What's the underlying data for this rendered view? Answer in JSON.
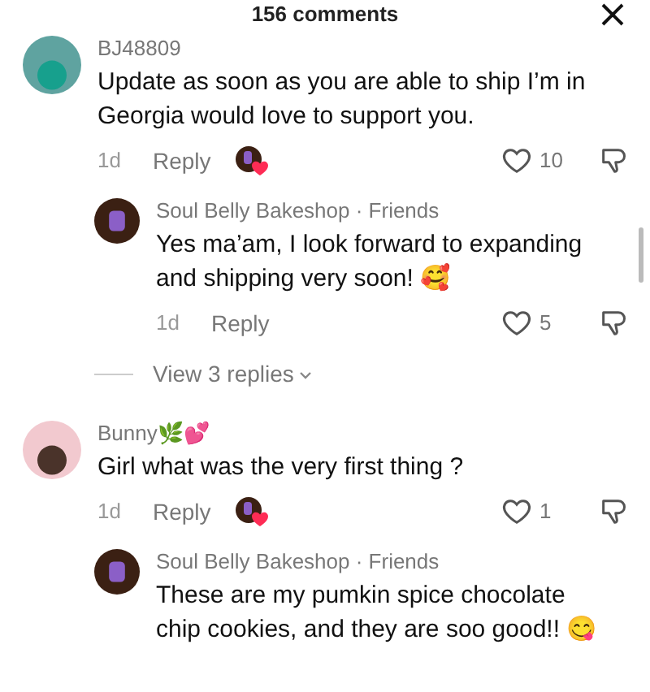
{
  "header": {
    "title": "156 comments"
  },
  "comments": [
    {
      "kind": "comment",
      "author": "BJ48809",
      "text": "Update as soon as you are able to ship I’m in Georgia would love to support you.",
      "time": "1d",
      "reply": "Reply",
      "creator_liked": true,
      "liked": false,
      "likes": "10"
    },
    {
      "kind": "reply",
      "author": "Soul Belly Bakeshop · Friends",
      "text": "Yes ma’am, I look forward to expanding and shipping very soon! 🥰",
      "time": "1d",
      "reply": "Reply",
      "liked": false,
      "likes": "5"
    },
    {
      "kind": "more",
      "text": "View 3 replies"
    },
    {
      "kind": "comment",
      "author": "Bunny🌿💕",
      "text": "Girl what was the very first thing ?",
      "time": "1d",
      "reply": "Reply",
      "creator_liked": true,
      "liked": false,
      "likes": "1"
    },
    {
      "kind": "reply",
      "author": "Soul Belly Bakeshop · Friends",
      "text": "These are my pumkin spice chocolate chip cookies, and they are soo good!! 😋"
    }
  ]
}
